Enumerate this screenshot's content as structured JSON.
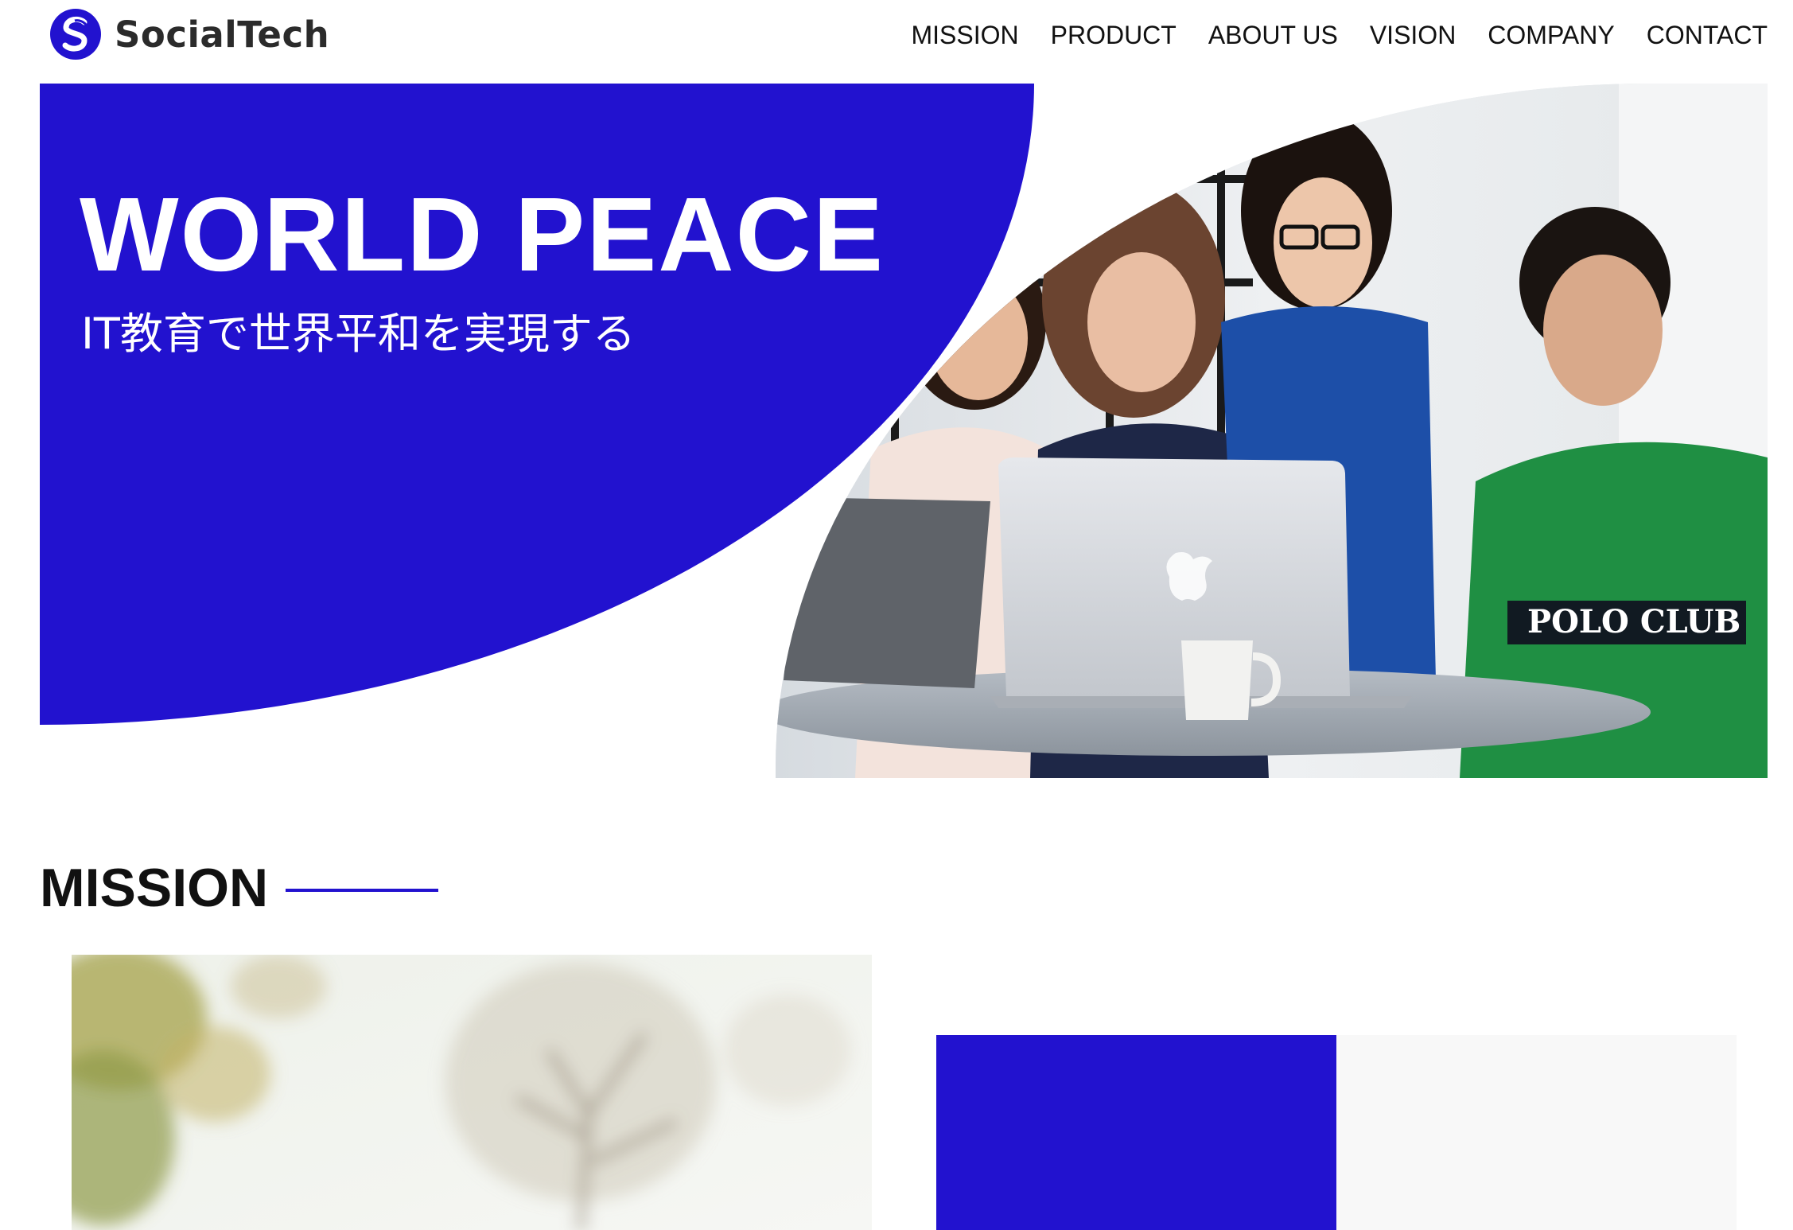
{
  "header": {
    "logo": {
      "text": "SocialTech",
      "icon": "socialtech-s-logo-icon",
      "color": "#2212cf"
    },
    "nav": [
      {
        "label": "MISSION"
      },
      {
        "label": "PRODUCT"
      },
      {
        "label": "ABOUT US"
      },
      {
        "label": "VISION"
      },
      {
        "label": "COMPANY"
      },
      {
        "label": "CONTACT"
      }
    ]
  },
  "hero": {
    "title": "WORLD PEACE",
    "subtitle": "IT教育で世界平和を実現する",
    "accent_color": "#2212cf",
    "photo": "team-around-laptop-photo"
  },
  "mission": {
    "heading": "MISSION",
    "photo": "blurred-tree-photo",
    "panel_colors": [
      "#2212cf",
      "#f8f8f8"
    ]
  }
}
